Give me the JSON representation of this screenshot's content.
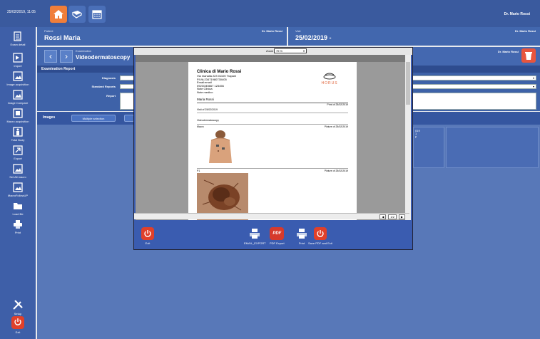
{
  "topbar": {
    "datetime": "25/02/2019, 11:05",
    "user": "Dr. Mario Rossi"
  },
  "sidebar": {
    "items": [
      {
        "label": "Exam detail",
        "icon": "document-icon"
      },
      {
        "label": "Import",
        "icon": "import-icon"
      },
      {
        "label": "Image acquisition",
        "icon": "image-icon"
      },
      {
        "label": "Image Compare",
        "icon": "image-compare-icon"
      },
      {
        "label": "Macro acquisition",
        "icon": "macro-icon"
      },
      {
        "label": "Total Body",
        "icon": "body-icon"
      },
      {
        "label": "Export",
        "icon": "export-icon"
      },
      {
        "label": "Set All macro",
        "icon": "image-icon"
      },
      {
        "label": "MacroFollowUP",
        "icon": "image-icon"
      },
      {
        "label": "Load file",
        "icon": "folder-icon"
      },
      {
        "label": "Print",
        "icon": "printer-icon"
      },
      {
        "label": "Setup",
        "icon": "tools-icon"
      },
      {
        "label": "Exit",
        "icon": "power-icon"
      }
    ]
  },
  "patient": {
    "label": "Patient",
    "name": "Rossi Maria",
    "doctor": "Dr. Mario Rossi"
  },
  "visit": {
    "label": "Visit",
    "date": "25/02/2019 -",
    "doctor": "Dr. Mario Rossi"
  },
  "examination": {
    "label": "Examination",
    "name": "Videodermatoscopy",
    "doctor": "Dr. Mario Rossi"
  },
  "report": {
    "header": "Examination Report",
    "diagnosis_label": "Diagnosis",
    "standard_label": "Standard Reports",
    "report_label": "Report"
  },
  "images": {
    "label": "Images",
    "multiple": "Multiple selection",
    "tile_text": [
      "019",
      "1",
      "p"
    ]
  },
  "dialog": {
    "zoom_label": "Zoom",
    "zoom_value": "75 %",
    "page": "1/2",
    "doc": {
      "clinic": "Clinica di Mario Rossi",
      "address": "Via manalla 223  01100  Trapani",
      "piva": "P.IVA:23471980730405",
      "email": "Email:email",
      "phone": "0923/345667  123456",
      "note_clinica": "Note Clinica",
      "note_medico": "Note medico",
      "logo": "HORUS",
      "patient": "Maria   Rossi",
      "print_of": "Print of 25/02/2019",
      "visit_of": "Visit of  25/02/2019",
      "exam": "Videodermatoscopy",
      "section1": "Macro",
      "picture1": "Picture of  25/02/2019",
      "section2": "P1",
      "picture2": "Picture of  25/02/2019"
    },
    "buttons": {
      "exit": "Exit",
      "email": "EMAIL_EXPORT",
      "pdf": "PDF Export",
      "print": "Print",
      "save": "Save PDF and Exit",
      "pdf_icon": "PDF"
    }
  }
}
